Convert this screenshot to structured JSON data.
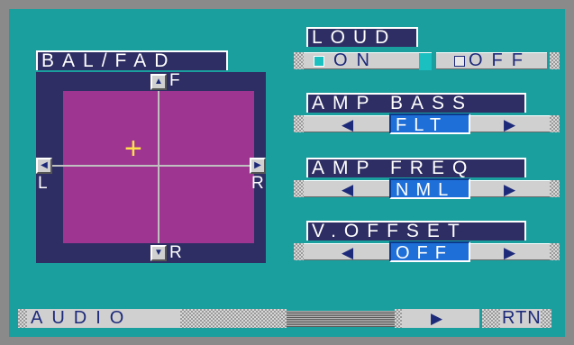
{
  "balfad": {
    "title": "BAL/FAD",
    "up_icon": "triangle-up",
    "down_icon": "triangle-down",
    "left_icon": "triangle-left",
    "right_icon": "triangle-right",
    "front_label": "F",
    "rear_label": "R",
    "left_label": "L",
    "right_label": "R",
    "cursor_glyph": "+",
    "colors": {
      "pad": "#9e3590",
      "frame": "#2e2e64",
      "cursor": "#ffe04a"
    }
  },
  "loud": {
    "title": "LOUD",
    "on_label": "ON",
    "off_label": "OFF",
    "selected": "ON"
  },
  "amp_bass": {
    "title": "AMP BASS",
    "value": "FLT",
    "prev_icon": "triangle-left",
    "next_icon": "triangle-right"
  },
  "amp_freq": {
    "title": "AMP FREQ",
    "value": "NML",
    "prev_icon": "triangle-left",
    "next_icon": "triangle-right"
  },
  "v_offset": {
    "title": "V.OFFSET",
    "value": "OFF",
    "prev_icon": "triangle-left",
    "next_icon": "triangle-right"
  },
  "bottom": {
    "source_label": "AUDIO",
    "next_icon": "triangle-right",
    "return_label": "RTN"
  },
  "colors": {
    "background": "#1a9e9e",
    "accent": "#1f6fd8",
    "bezel": "#8a8a8a"
  }
}
